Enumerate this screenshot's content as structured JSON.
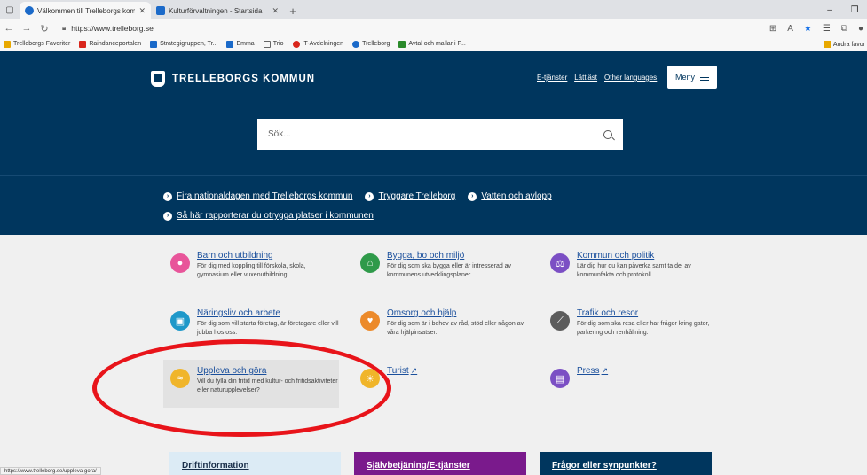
{
  "browser": {
    "tabs": [
      {
        "title": "Välkommen till Trelleborgs komm",
        "active": true
      },
      {
        "title": "Kulturförvaltningen - Startsida",
        "active": false
      }
    ],
    "new_tab": "+",
    "url": "https://www.trelleborg.se",
    "bookmarks": [
      {
        "label": "Trelleborgs Favoriter",
        "icon": "folder-icon",
        "color": "#e8a800"
      },
      {
        "label": "Raindanceportalen",
        "icon": "raindance-icon",
        "color": "#d9261c"
      },
      {
        "label": "Strategigruppen, Tr...",
        "icon": "sharepoint-icon",
        "color": "#1b6ac9"
      },
      {
        "label": "Emma",
        "icon": "sharepoint-icon",
        "color": "#1b6ac9"
      },
      {
        "label": "Trio",
        "icon": "page-icon",
        "color": "#666666"
      },
      {
        "label": "IT-Avdelningen",
        "icon": "it-icon",
        "color": "#d9261c"
      },
      {
        "label": "Trelleborg",
        "icon": "site-icon",
        "color": "#1b6ac9"
      },
      {
        "label": "Avtal och mallar i F...",
        "icon": "link-icon",
        "color": "#2a8a2a"
      }
    ],
    "bookmarks_other": "Andra favor",
    "status_url": "https://www.trelleborg.se/uppleva-gora/"
  },
  "header": {
    "logo_text": "TRELLEBORGS KOMMUN",
    "links": [
      "E-tjänster",
      "Lättläst",
      "Other languages"
    ],
    "menu_label": "Meny",
    "search_placeholder": "Sök..."
  },
  "news": [
    "Fira nationaldagen med Trelleborgs kommun",
    "Tryggare Trelleborg",
    "Vatten och avlopp",
    "Så här rapporterar du otrygga platser i kommunen"
  ],
  "categories": [
    {
      "title": "Barn och utbildning",
      "desc": "För dig med koppling till förskola, skola, gymnasium eller vuxenutbildning.",
      "icon": "apple-icon",
      "color": "#e8559a"
    },
    {
      "title": "Bygga, bo och miljö",
      "desc": "För dig som ska bygga eller är intresserad av kommunens utvecklingsplaner.",
      "icon": "house-tree-icon",
      "color": "#2f9a4a"
    },
    {
      "title": "Kommun och politik",
      "desc": "Lär dig hur du kan påverka samt ta del av kommunfakta och protokoll.",
      "icon": "gavel-icon",
      "color": "#7b4fc4"
    },
    {
      "title": "Näringsliv och arbete",
      "desc": "För dig som vill starta företag, är företagare eller vill jobba hos oss.",
      "icon": "briefcase-icon",
      "color": "#1e98c9"
    },
    {
      "title": "Omsorg och hjälp",
      "desc": "För dig som är i behov av råd, stöd eller någon av våra hjälpinsatser.",
      "icon": "heart-icon",
      "color": "#ec8a2a"
    },
    {
      "title": "Trafik och resor",
      "desc": "För dig som ska resa eller har frågor kring gator, parkering och renhållning.",
      "icon": "road-icon",
      "color": "#5c5c5c"
    },
    {
      "title": "Uppleva och göra",
      "desc": "Vill du fylla din fritid med kultur- och fritidsaktiviteter eller naturupplevelser?",
      "icon": "swimmer-icon",
      "color": "#f0b52a"
    },
    {
      "title": "Turist",
      "desc": "",
      "icon": "sun-wave-icon",
      "color": "#f0b52a"
    },
    {
      "title": "Press",
      "desc": "",
      "icon": "newspaper-icon",
      "color": "#7b4fc4"
    }
  ],
  "footer": {
    "drift": "Driftinformation",
    "self_service": "Självbetjäning/E-tjänster",
    "questions": "Frågor eller synpunkter?"
  }
}
